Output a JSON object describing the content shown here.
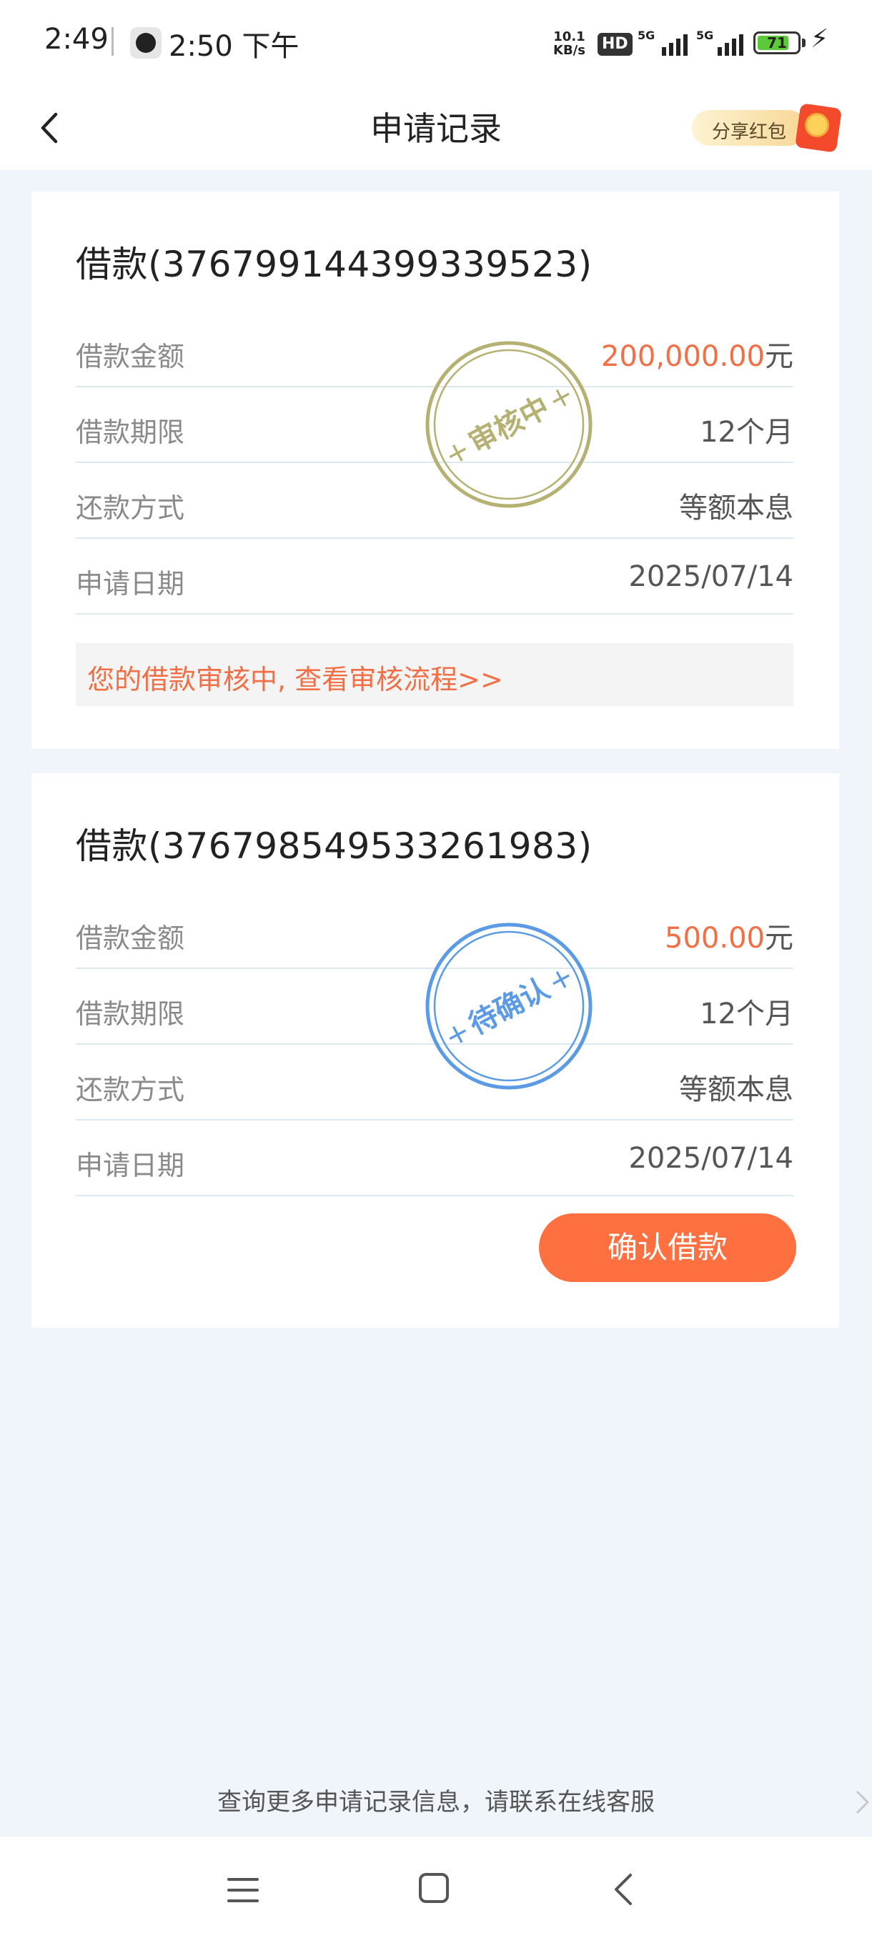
{
  "status_bar": {
    "time": "2:49",
    "time2": "2:50 下午",
    "net_speed_value": "10.1",
    "net_speed_unit": "KB/s",
    "hd_label": "HD",
    "sim1_label": "5G",
    "sim2_label": "5G",
    "battery": "71"
  },
  "header": {
    "title": "申请记录",
    "share_label": "分享红包"
  },
  "loans": [
    {
      "title": "借款(376799144399339523)",
      "amount_label": "借款金额",
      "amount_value": "200,000.00",
      "amount_unit": "元",
      "term_label": "借款期限",
      "term_value": "12个月",
      "method_label": "还款方式",
      "method_value": "等额本息",
      "date_label": "申请日期",
      "date_value": "2025/07/14",
      "stamp_text": "审核中",
      "stamp_color": "#b5b173",
      "notice": "您的借款审核中, 查看审核流程>>"
    },
    {
      "title": "借款(376798549533261983)",
      "amount_label": "借款金额",
      "amount_value": "500.00",
      "amount_unit": "元",
      "term_label": "借款期限",
      "term_value": "12个月",
      "method_label": "还款方式",
      "method_value": "等额本息",
      "date_label": "申请日期",
      "date_value": "2025/07/14",
      "stamp_text": "待确认",
      "stamp_color": "#5b9be6",
      "button": "确认借款"
    }
  ],
  "footer_note": "查询更多申请记录信息，请联系在线客服",
  "colors": {
    "accent": "#fe7040",
    "amount": "#f26f45",
    "background": "#f0f4fb"
  }
}
